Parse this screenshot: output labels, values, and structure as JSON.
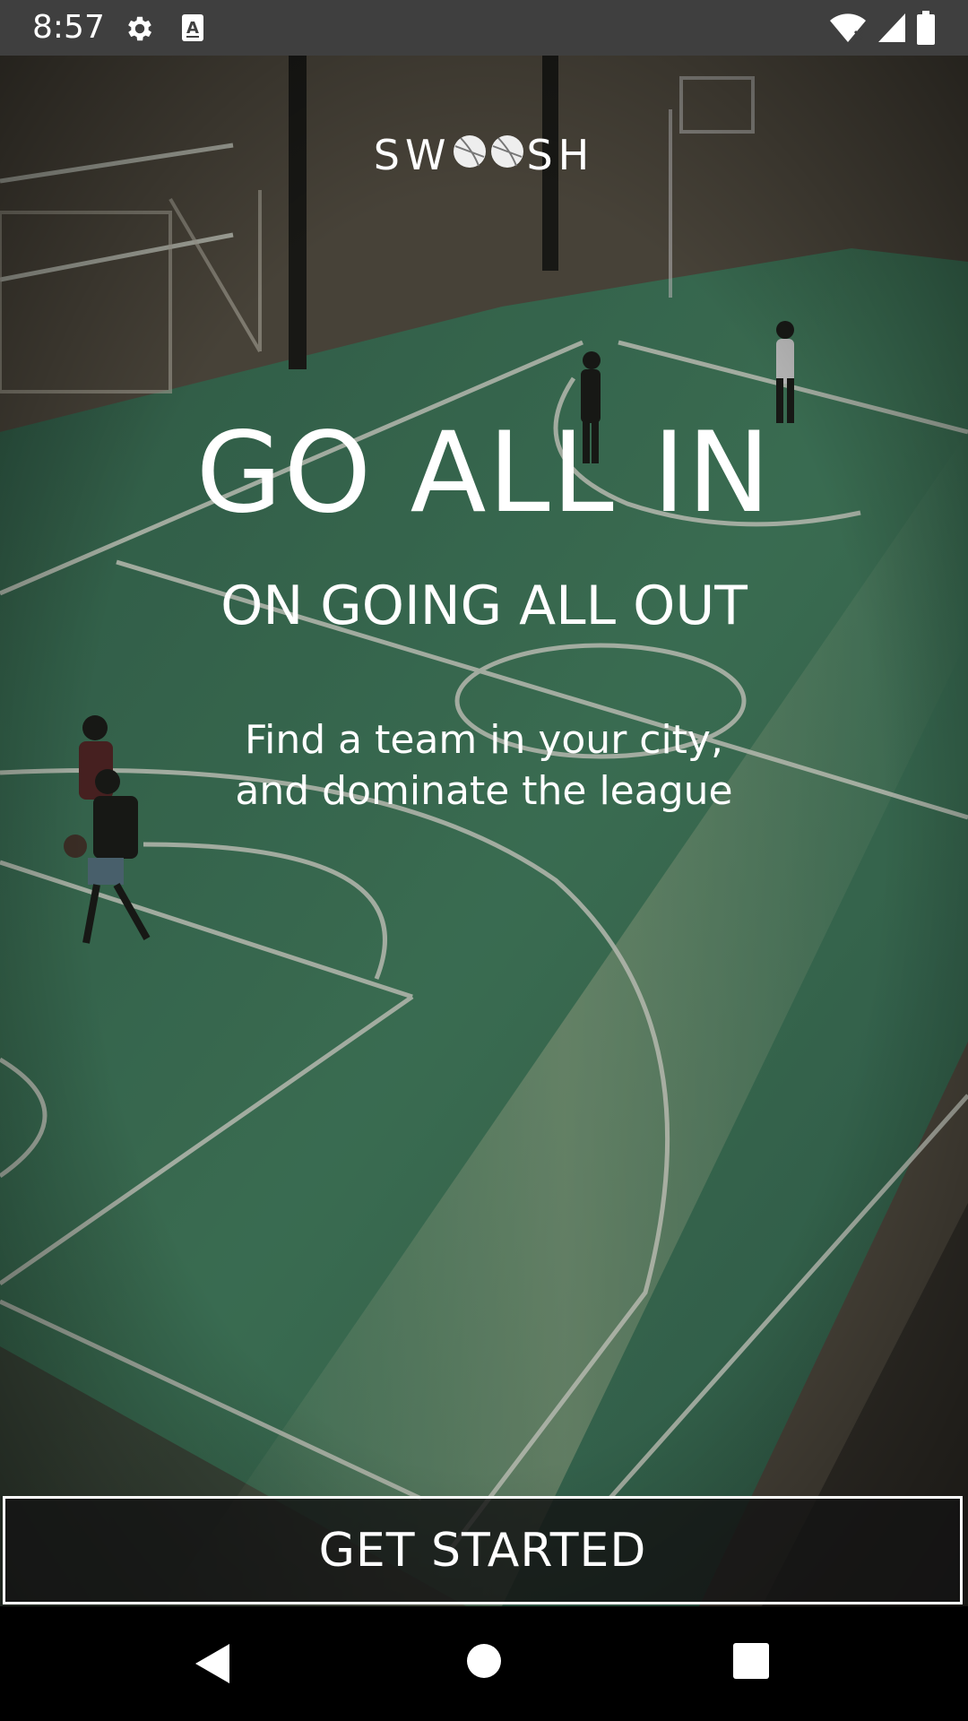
{
  "status_bar": {
    "time": "8:57",
    "icons": [
      "settings-gear-icon",
      "a-keyboard-icon",
      "wifi-icon",
      "cell-signal-icon",
      "battery-icon"
    ]
  },
  "brand": {
    "logo_text_left": "SW",
    "logo_text_right": "SH"
  },
  "hero": {
    "headline": "GO ALL IN",
    "subheadline": "ON GOING ALL OUT",
    "tagline": "Find a team in your city, and dominate the league"
  },
  "cta": {
    "label": "GET STARTED"
  },
  "nav_bar": {
    "icons": [
      "back-triangle-icon",
      "home-circle-icon",
      "recents-square-icon"
    ]
  },
  "colors": {
    "court_green": "#4f8a6a",
    "status_bar": "#3f3f3f",
    "text": "#ffffff"
  }
}
